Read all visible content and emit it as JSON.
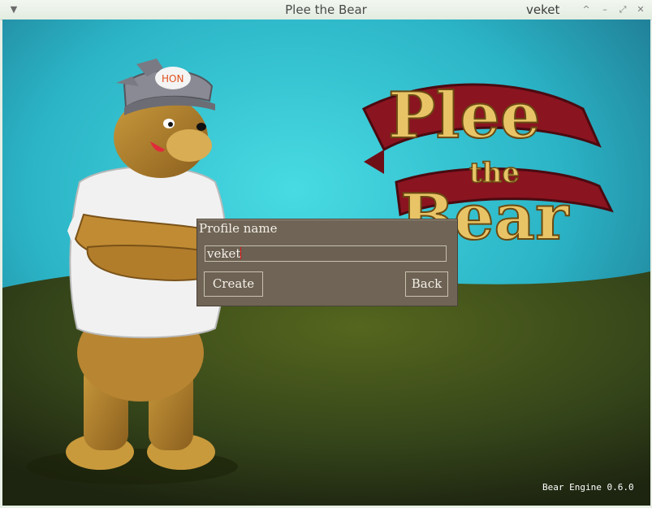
{
  "window": {
    "title": "Plee the Bear",
    "user": "veket",
    "menu_icon": "chevron-down-icon",
    "controls": [
      "caret-up-icon",
      "minimize-icon",
      "maximize-icon",
      "close-icon"
    ]
  },
  "scene": {
    "logo": {
      "word1": "Plee",
      "word2": "the",
      "word3": "Bear"
    },
    "bear_cap_text": "HON",
    "colors": {
      "sky": "#33c3cf",
      "hill": "#3b4a16",
      "banner": "#8a1420",
      "logo_text": "#e8c467"
    }
  },
  "dialog": {
    "title": "Profile name",
    "input_value": "veket",
    "create_label": "Create",
    "back_label": "Back"
  },
  "footer": {
    "engine_version": "Bear Engine 0.6.0"
  }
}
